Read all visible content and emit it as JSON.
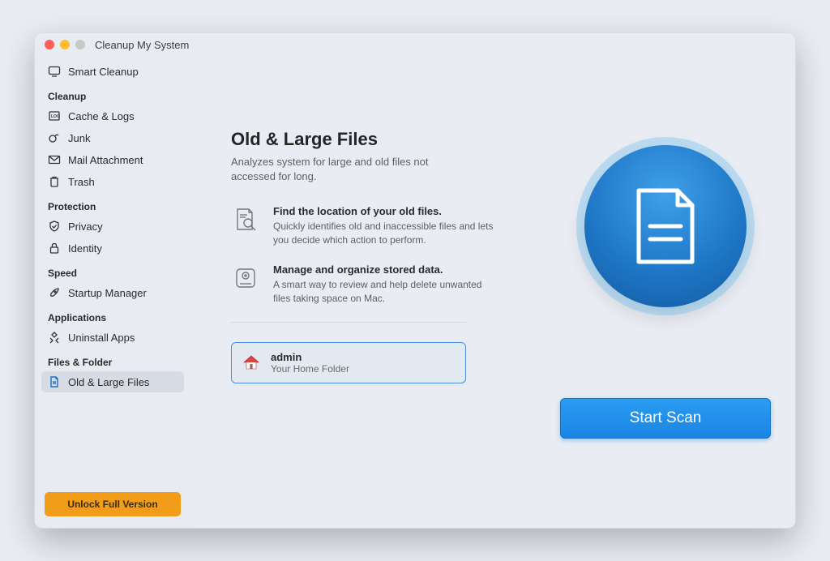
{
  "app": {
    "title": "Cleanup My System"
  },
  "sidebar": {
    "smart": "Smart Cleanup",
    "sections": [
      {
        "label": "Cleanup",
        "items": [
          "Cache & Logs",
          "Junk",
          "Mail Attachment",
          "Trash"
        ]
      },
      {
        "label": "Protection",
        "items": [
          "Privacy",
          "Identity"
        ]
      },
      {
        "label": "Speed",
        "items": [
          "Startup Manager"
        ]
      },
      {
        "label": "Applications",
        "items": [
          "Uninstall Apps"
        ]
      },
      {
        "label": "Files & Folder",
        "items": [
          "Old & Large Files"
        ]
      }
    ],
    "unlock": "Unlock Full Version"
  },
  "main": {
    "title": "Old & Large Files",
    "subtitle": "Analyzes system for large and old files not accessed for long.",
    "features": [
      {
        "title": "Find the location of your old files.",
        "desc": "Quickly identifies old and inaccessible files and lets you decide which action to perform."
      },
      {
        "title": "Manage and organize stored data.",
        "desc": "A smart way to review and help delete unwanted files taking space on Mac."
      }
    ],
    "folder": {
      "name": "admin",
      "sub": "Your Home Folder"
    },
    "scan": "Start Scan"
  }
}
